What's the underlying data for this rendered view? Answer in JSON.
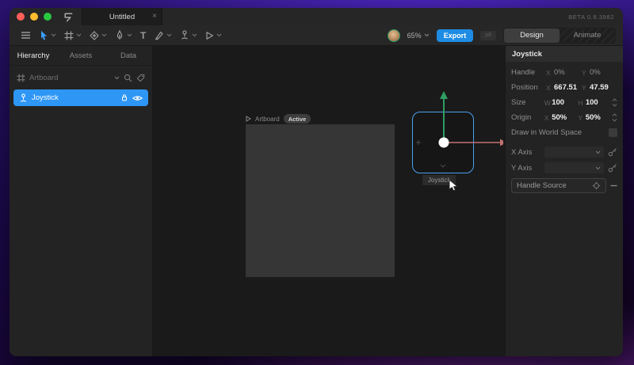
{
  "window": {
    "beta_label": "BETA 0.8.3982",
    "tab_title": "Untitled",
    "close_glyph": "×"
  },
  "toolbar": {
    "zoom_value": "65%",
    "export_label": "Export",
    "aux_label": "p8",
    "design_label": "Design",
    "animate_label": "Animate",
    "text_tool_glyph": "T"
  },
  "sidebar": {
    "tabs": [
      {
        "label": "Hierarchy",
        "active": true
      },
      {
        "label": "Assets",
        "active": false
      },
      {
        "label": "Data",
        "active": false
      }
    ],
    "root_item": "Artboard",
    "selected_item": "Joystick"
  },
  "canvas": {
    "artboard_label": "Artboard",
    "artboard_badge": "Active",
    "node_label": "Joystick"
  },
  "inspector": {
    "title": "Joystick",
    "handle": {
      "label": "Handle",
      "x_key": "X",
      "x_value": "0%",
      "y_key": "Y",
      "y_value": "0%"
    },
    "position": {
      "label": "Position",
      "x_key": "X",
      "x_value": "667.51",
      "y_key": "Y",
      "y_value": "47.59"
    },
    "size": {
      "label": "Size",
      "x_key": "W",
      "x_value": "100",
      "y_key": "H",
      "y_value": "100"
    },
    "origin": {
      "label": "Origin",
      "x_key": "X",
      "x_value": "50%",
      "y_key": "Y",
      "y_value": "50%"
    },
    "world_space_label": "Draw in World Space",
    "x_axis_label": "X Axis",
    "y_axis_label": "Y Axis",
    "handle_source_label": "Handle Source"
  },
  "colors": {
    "accent_blue": "#2e96f5",
    "export_blue": "#1e8ce5",
    "selection_border": "#4aa0f0",
    "arrow_green": "#2f9e62",
    "arrow_red": "#c47070",
    "artboard_gray": "#363636"
  }
}
